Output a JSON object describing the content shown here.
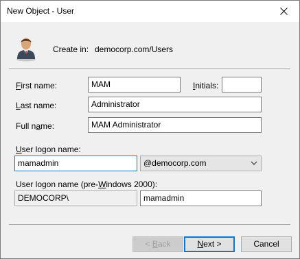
{
  "window": {
    "title": "New Object - User",
    "close_glyph": "close-icon"
  },
  "header": {
    "icon": "user-icon",
    "create_in_label": "Create in:",
    "create_in_value": "democorp.com/Users"
  },
  "form": {
    "first_name": {
      "label_pre": "",
      "label_ul": "F",
      "label_post": "irst name:",
      "value": "MAM"
    },
    "initials": {
      "label_pre": "",
      "label_ul": "I",
      "label_post": "nitials:",
      "value": ""
    },
    "last_name": {
      "label_pre": "",
      "label_ul": "L",
      "label_post": "ast name:",
      "value": "Administrator"
    },
    "full_name": {
      "label_pre": "Full n",
      "label_ul": "a",
      "label_post": "me:",
      "value": "MAM Administrator"
    },
    "logon_name": {
      "label_pre": "",
      "label_ul": "U",
      "label_post": "ser logon name:",
      "value": "mamadmin"
    },
    "domain_suffix": {
      "selected": "@democorp.com"
    },
    "pre2000": {
      "label_pre": "User logon name (pre-",
      "label_ul": "W",
      "label_post": "indows 2000):",
      "domain_value": "DEMOCORP\\",
      "name_value": "mamadmin"
    }
  },
  "buttons": {
    "back": {
      "pre": "< ",
      "ul": "B",
      "post": "ack"
    },
    "next": {
      "pre": "",
      "ul": "N",
      "post": "ext >"
    },
    "cancel": "Cancel"
  }
}
